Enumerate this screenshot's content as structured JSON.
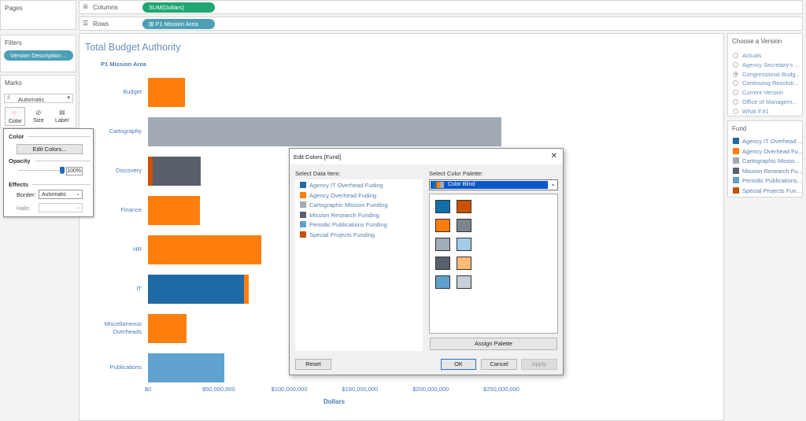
{
  "shelves": {
    "pages_label": "Pages",
    "columns_label": "Columns",
    "columns_pill": "SUM(Dollars)",
    "rows_label": "Rows",
    "rows_pill": "⊞ P1 Mission Area"
  },
  "filters": {
    "title": "Filters",
    "pill": "Version Description .."
  },
  "marks": {
    "title": "Marks",
    "type": "Automatic",
    "color_label": "Color",
    "size_label": "Size",
    "label_label": "Label"
  },
  "color_popup": {
    "title": "Color",
    "edit_button": "Edit Colors...",
    "opacity_label": "Opacity",
    "opacity_value": "100%",
    "opacity": 1.0,
    "effects_label": "Effects",
    "border_label": "Border:",
    "border_value": "Automatic",
    "halo_label": "Halo:"
  },
  "chart": {
    "title": "Total Budget Authority",
    "row_header": "P1 Mission Area",
    "xlabel": "Dollars"
  },
  "chart_data": {
    "type": "bar",
    "orientation": "horizontal",
    "stacked": true,
    "title": "Total Budget Authority",
    "xlabel": "Dollars",
    "ylabel": "P1 Mission Area",
    "xlim": [
      0,
      250000000
    ],
    "x_ticks": [
      "$0",
      "$50,000,000",
      "$100,000,000",
      "$150,000,000",
      "$200,000,000",
      "$250,000,000"
    ],
    "categories": [
      "Budget",
      "Cartography",
      "Discovery",
      "Finance",
      "HR",
      "IT",
      "Miscellaneous Overheads",
      "Publications"
    ],
    "series": [
      {
        "name": "Agency IT Overhead Fuding",
        "color": "#1f6aa5",
        "values": [
          0,
          0,
          0,
          0,
          0,
          68000000,
          0,
          0
        ]
      },
      {
        "name": "Agency Overhead Fuding",
        "color": "#ff7f0e",
        "values": [
          26000000,
          0,
          0,
          37000000,
          80000000,
          3000000,
          27500000,
          0
        ]
      },
      {
        "name": "Cartographic Mission Funding",
        "color": "#a2aab5",
        "values": [
          0,
          250000000,
          0,
          0,
          0,
          0,
          0,
          0
        ]
      },
      {
        "name": "Mission Research Funding",
        "color": "#5a606b",
        "values": [
          0,
          0,
          34000000,
          0,
          0,
          0,
          0,
          0
        ]
      },
      {
        "name": "Periodic Publications Funding",
        "color": "#5fa2d0",
        "values": [
          0,
          0,
          0,
          0,
          0,
          0,
          0,
          54000000
        ]
      },
      {
        "name": "Special Projects Funding",
        "color": "#c85200",
        "values": [
          0,
          0,
          3500000,
          0,
          0,
          0,
          0,
          0
        ]
      }
    ]
  },
  "version_panel": {
    "title": "Choose a Version",
    "options": [
      "Actuals",
      "Agency Secretary's ...",
      "Congressional Budg...",
      "Continuing Resoluti...",
      "Current Version",
      "Office of Managem...",
      "What if #1"
    ],
    "selected_index": 2
  },
  "fund_legend": {
    "title": "Fund",
    "items": [
      {
        "label": "Agency IT Overhead ...",
        "color": "#1f6aa5"
      },
      {
        "label": "Agency Overhead Fu...",
        "color": "#ff7f0e"
      },
      {
        "label": "Cartographic Missio...",
        "color": "#a2aab5"
      },
      {
        "label": "Mission Research Fu...",
        "color": "#5a606b"
      },
      {
        "label": "Periodic Publications...",
        "color": "#5fa2d0"
      },
      {
        "label": "Special Projects Fun...",
        "color": "#c85200"
      }
    ]
  },
  "dialog": {
    "title": "Edit Colors [Fund]",
    "close": "✕",
    "select_data_label": "Select Data Item:",
    "select_palette_label": "Select Color Palette:",
    "palette_value": "Color Blind",
    "items": [
      {
        "label": "Agency IT Overhead Fuding",
        "color": "#1f6aa5"
      },
      {
        "label": "Agency Overhead Fuding",
        "color": "#ff7f0e"
      },
      {
        "label": "Cartographic Mission Funding",
        "color": "#a2aab5"
      },
      {
        "label": "Mission Research Funding",
        "color": "#5a606b"
      },
      {
        "label": "Periodic Publications Funding",
        "color": "#5fa2d0"
      },
      {
        "label": "Special Projects Funding",
        "color": "#c85200"
      }
    ],
    "palette_colors": [
      "#1170aa",
      "#c85200",
      "#fc7d0b",
      "#7b848f",
      "#a3acb9",
      "#a3cce9",
      "#57606c",
      "#ffbc79",
      "#5fa2ce",
      "#c8d0d9"
    ],
    "assign_button": "Assign Palette",
    "reset_button": "Reset",
    "ok_button": "OK",
    "cancel_button": "Cancel",
    "apply_button": "Apply"
  }
}
